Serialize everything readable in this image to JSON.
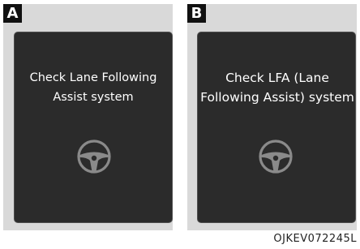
{
  "panels": [
    {
      "label": "A",
      "message_line1": "Check Lane Following",
      "message_line2": "Assist system",
      "icon": "steering-wheel-icon"
    },
    {
      "label": "B",
      "message_line1": "Check LFA (Lane",
      "message_line2": "Following Assist) system",
      "icon": "steering-wheel-icon"
    }
  ],
  "figure_code": "OJKEV072245L",
  "colors": {
    "screen_background": "#2b2b2b",
    "frame_background": "#d9d9d9",
    "icon_gray": "#8a8a8a",
    "text": "#ffffff"
  }
}
